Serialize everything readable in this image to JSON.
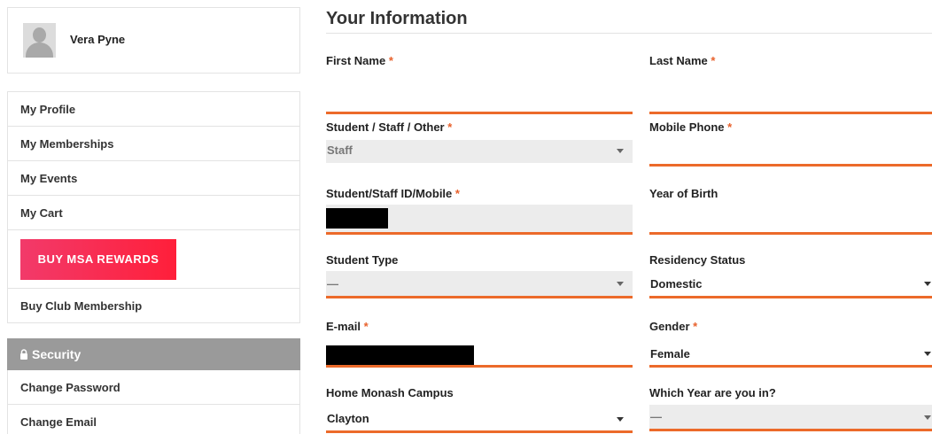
{
  "profile": {
    "name": "Vera Pyne"
  },
  "menu": {
    "items": [
      {
        "label": "My Profile"
      },
      {
        "label": "My Memberships"
      },
      {
        "label": "My Events"
      },
      {
        "label": "My Cart"
      }
    ],
    "rewards_button": "BUY MSA REWARDS",
    "club_membership": "Buy Club Membership"
  },
  "security": {
    "header": "Security",
    "items": [
      {
        "label": "Change Password"
      },
      {
        "label": "Change Email"
      }
    ]
  },
  "form": {
    "title": "Your Information",
    "required_mark": "*",
    "first_name": {
      "label": "First Name",
      "value": ""
    },
    "last_name": {
      "label": "Last Name",
      "value": ""
    },
    "role": {
      "label": "Student / Staff / Other",
      "value": "Staff"
    },
    "mobile_phone": {
      "label": "Mobile Phone",
      "value": ""
    },
    "student_id": {
      "label": "Student/Staff ID/Mobile",
      "value": ""
    },
    "year_of_birth": {
      "label": "Year of Birth",
      "value": ""
    },
    "student_type": {
      "label": "Student Type",
      "value": "—"
    },
    "residency": {
      "label": "Residency Status",
      "value": "Domestic"
    },
    "email": {
      "label": "E-mail",
      "value": ""
    },
    "gender": {
      "label": "Gender",
      "value": "Female"
    },
    "campus": {
      "label": "Home Monash Campus",
      "value": "Clayton"
    },
    "year_in": {
      "label": "Which Year are you in?",
      "value": "—"
    }
  },
  "colors": {
    "accent": "#ec6a2a",
    "rewards": "#ff1f3a",
    "security_header": "#9a9a9a"
  },
  "icons": {
    "lock": "lock-icon",
    "avatar": "avatar",
    "dropdown": "chevron-down-icon"
  }
}
